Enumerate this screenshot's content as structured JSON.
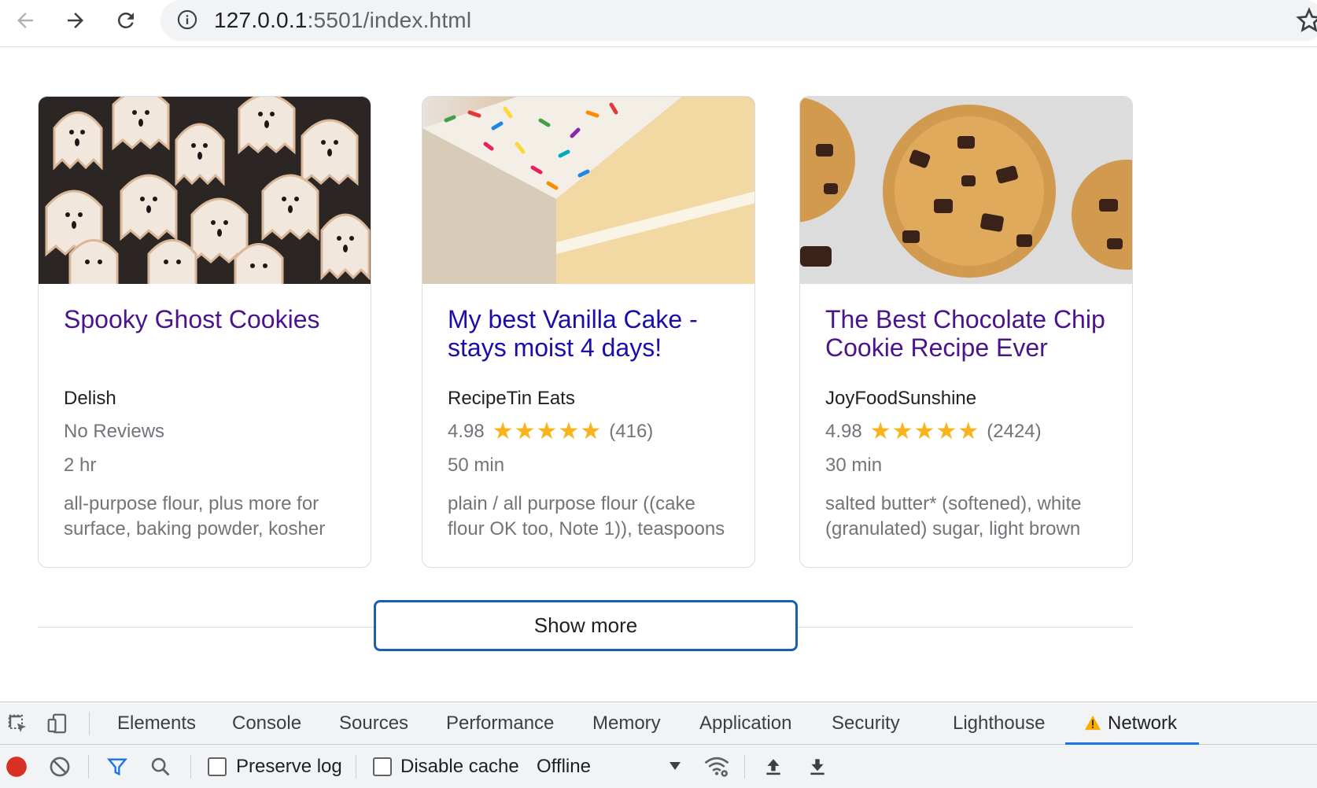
{
  "browser": {
    "url_host": "127.0.0.1",
    "url_rest": ":5501/index.html"
  },
  "cards": [
    {
      "title": "Spooky Ghost Cookies",
      "source": "Delish",
      "rating_text": "No Reviews",
      "time": "2 hr",
      "ingredients": "all-purpose flour, plus more for surface, baking powder, kosher"
    },
    {
      "title": "My best Vanilla Cake - stays moist 4 days!",
      "source": "RecipeTin Eats",
      "rating": "4.98",
      "reviews": "(416)",
      "stars": 5,
      "time": "50 min",
      "ingredients": "plain / all purpose flour ((cake flour OK too, Note 1)), teaspoons"
    },
    {
      "title": "The Best Chocolate Chip Cookie Recipe Ever",
      "source": "JoyFoodSunshine",
      "rating": "4.98",
      "reviews": "(2424)",
      "stars": 5,
      "time": "30 min",
      "ingredients": "salted butter* (softened), white (granulated) sugar, light brown"
    }
  ],
  "show_more_label": "Show more",
  "devtools": {
    "tabs": [
      "Elements",
      "Console",
      "Sources",
      "Performance",
      "Memory",
      "Application",
      "Security",
      "Lighthouse",
      "Network"
    ],
    "active_tab": "Network",
    "preserve_log_label": "Preserve log",
    "disable_cache_label": "Disable cache",
    "throttle_value": "Offline"
  },
  "colors": {
    "visited_link": "#4a148c",
    "link": "#1a0dab",
    "star": "#f9b31d",
    "focus_ring": "#1a5fb4",
    "active_tab_underline": "#1a73e8",
    "record_red": "#d93025"
  }
}
